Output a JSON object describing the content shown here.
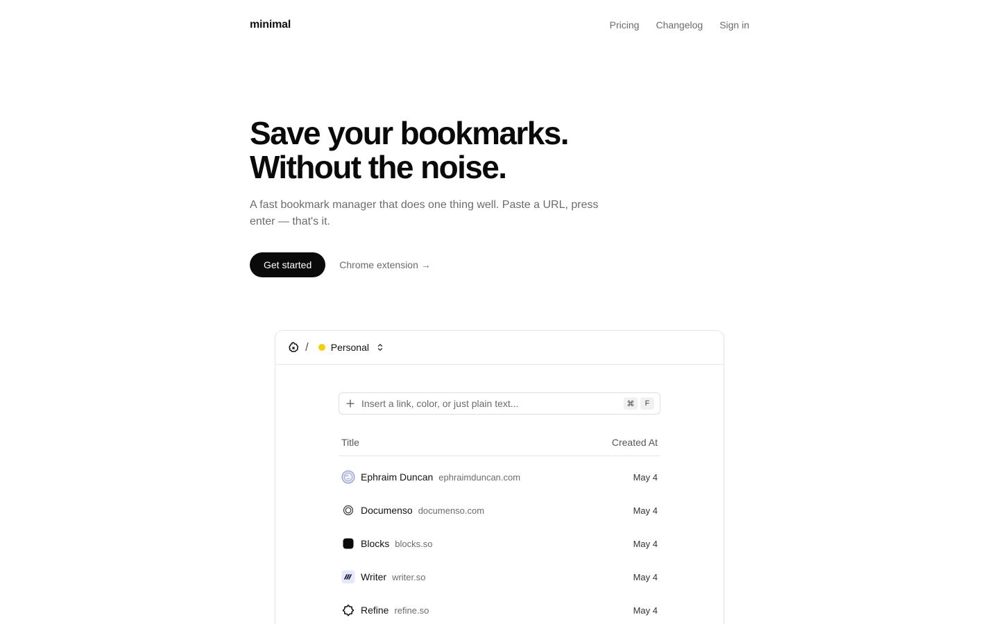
{
  "header": {
    "logo": "minimal",
    "links": [
      "Pricing",
      "Changelog",
      "Sign in"
    ]
  },
  "hero": {
    "title_line1": "Save your bookmarks.",
    "title_line2": "Without the noise.",
    "subtitle": "A fast bookmark manager that does one thing well. Paste a URL, press enter — that's it.",
    "primary_cta": "Get started",
    "secondary_cta": "Chrome extension →"
  },
  "preview": {
    "separator": "/",
    "workspace": {
      "name": "Personal",
      "color": "#f5cf08"
    },
    "insert": {
      "placeholder": "Insert a link, color, or just plain text...",
      "shortcut_mod": "⌘",
      "shortcut_key": "F"
    },
    "table": {
      "columns": [
        "Title",
        "Created At"
      ],
      "rows": [
        {
          "title": "Ephraim Duncan",
          "domain": "ephraimduncan.com",
          "date": "May 4",
          "icon": "globe-avatar-icon"
        },
        {
          "title": "Documenso",
          "domain": "documenso.com",
          "date": "May 4",
          "icon": "documenso-logo-icon"
        },
        {
          "title": "Blocks",
          "domain": "blocks.so",
          "date": "May 4",
          "icon": "blocks-logo-icon"
        },
        {
          "title": "Writer",
          "domain": "writer.so",
          "date": "May 4",
          "icon": "writer-logo-icon"
        },
        {
          "title": "Refine",
          "domain": "refine.so",
          "date": "May 4",
          "icon": "refine-logo-icon"
        }
      ]
    }
  },
  "colors": {
    "primary": "#0a0a0a",
    "muted_text": "#6b6b6b",
    "border": "#e4e4e4",
    "workspace_dot": "#f5cf08"
  }
}
